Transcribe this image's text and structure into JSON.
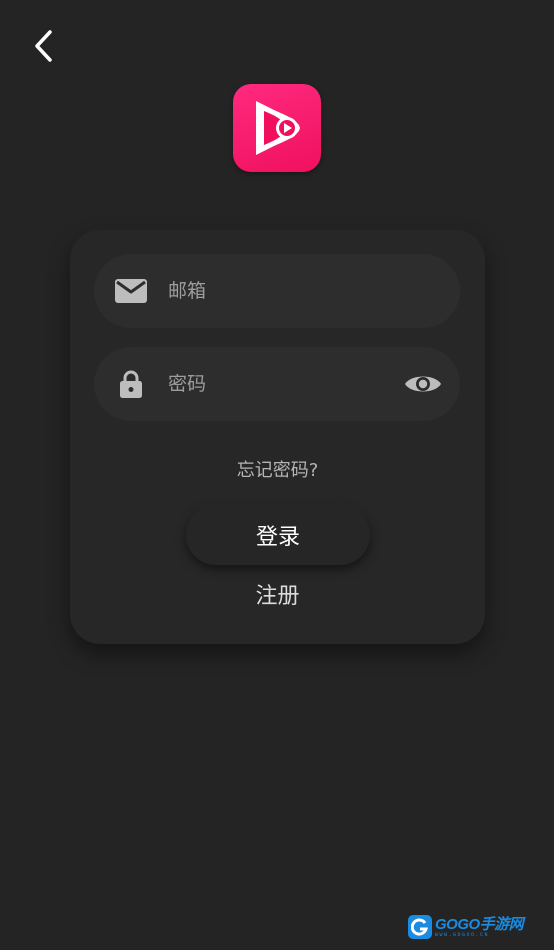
{
  "login": {
    "email_placeholder": "邮箱",
    "password_placeholder": "密码",
    "forgot_password": "忘记密码?",
    "login_button": "登录",
    "register_link": "注册"
  },
  "icons": {
    "back": "chevron-left-icon",
    "logo": "play-logo",
    "email": "mail-icon",
    "password": "lock-icon",
    "visibility": "eye-icon"
  },
  "colors": {
    "background": "#242424",
    "card": "#272727",
    "field": "#2d2d2d",
    "logo_accent": "#f0105e"
  },
  "watermark": {
    "main": "GOGO手游网",
    "sub": "WWW.GOGOO.CN"
  }
}
